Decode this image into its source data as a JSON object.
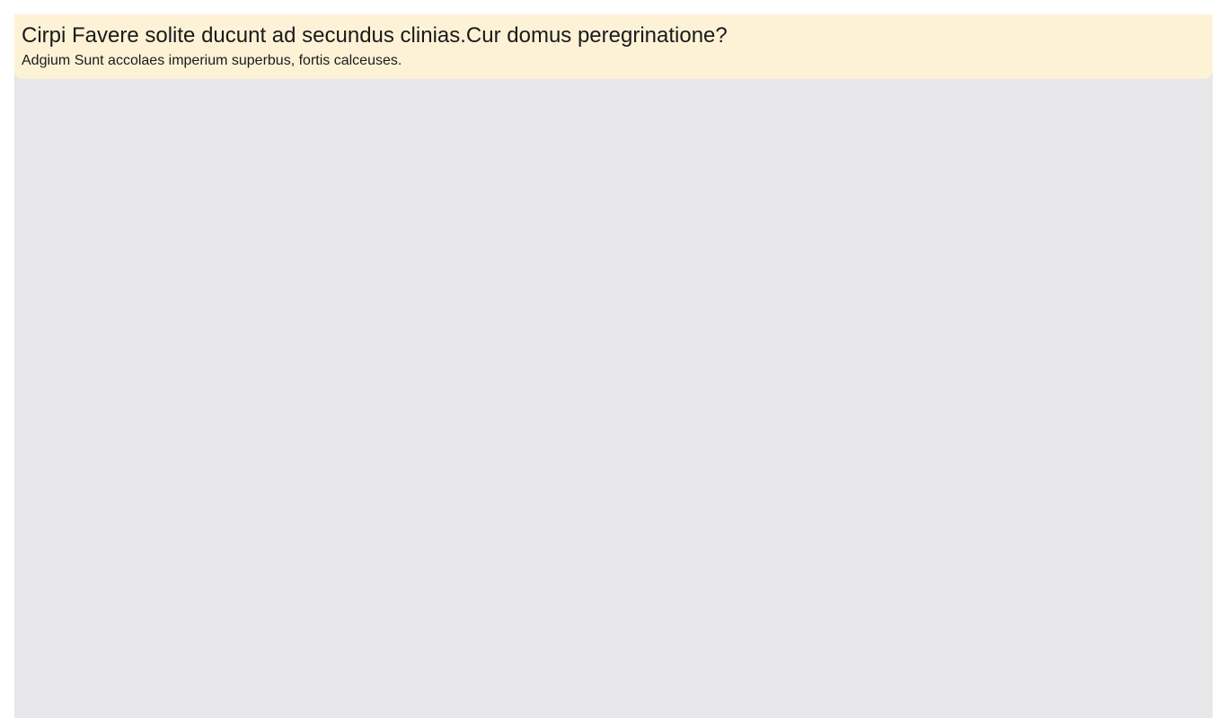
{
  "banner": {
    "title": "Cirpi Favere solite ducunt ad secundus clinias.Cur domus peregrinatione?",
    "subtitle": "Adgium Sunt accolaes imperium superbus, fortis calceuses."
  },
  "colors": {
    "banner_background": "#fef2d6",
    "content_background": "#e7e7e9",
    "text": "#1a1a1a"
  }
}
